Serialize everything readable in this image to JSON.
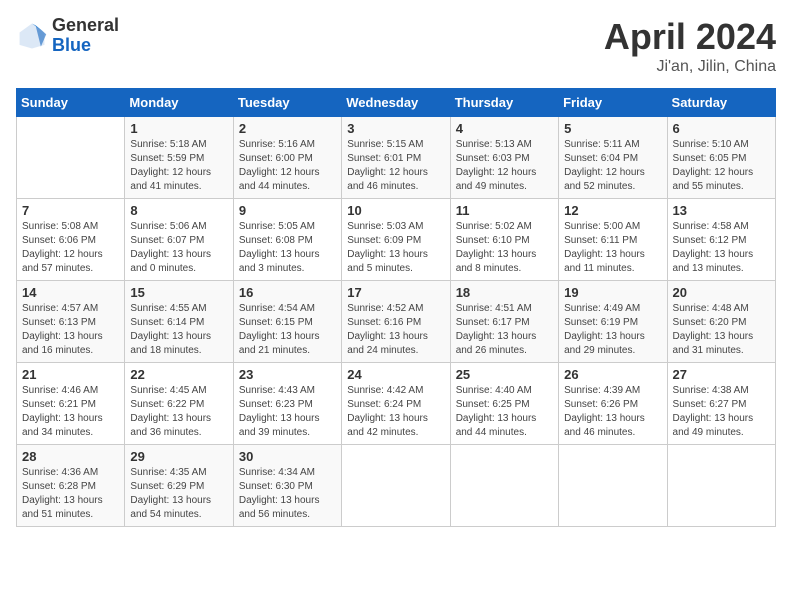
{
  "header": {
    "logo_general": "General",
    "logo_blue": "Blue",
    "title": "April 2024",
    "subtitle": "Ji'an, Jilin, China"
  },
  "days_of_week": [
    "Sunday",
    "Monday",
    "Tuesday",
    "Wednesday",
    "Thursday",
    "Friday",
    "Saturday"
  ],
  "weeks": [
    [
      {
        "day": "",
        "info": ""
      },
      {
        "day": "1",
        "info": "Sunrise: 5:18 AM\nSunset: 5:59 PM\nDaylight: 12 hours\nand 41 minutes."
      },
      {
        "day": "2",
        "info": "Sunrise: 5:16 AM\nSunset: 6:00 PM\nDaylight: 12 hours\nand 44 minutes."
      },
      {
        "day": "3",
        "info": "Sunrise: 5:15 AM\nSunset: 6:01 PM\nDaylight: 12 hours\nand 46 minutes."
      },
      {
        "day": "4",
        "info": "Sunrise: 5:13 AM\nSunset: 6:03 PM\nDaylight: 12 hours\nand 49 minutes."
      },
      {
        "day": "5",
        "info": "Sunrise: 5:11 AM\nSunset: 6:04 PM\nDaylight: 12 hours\nand 52 minutes."
      },
      {
        "day": "6",
        "info": "Sunrise: 5:10 AM\nSunset: 6:05 PM\nDaylight: 12 hours\nand 55 minutes."
      }
    ],
    [
      {
        "day": "7",
        "info": "Sunrise: 5:08 AM\nSunset: 6:06 PM\nDaylight: 12 hours\nand 57 minutes."
      },
      {
        "day": "8",
        "info": "Sunrise: 5:06 AM\nSunset: 6:07 PM\nDaylight: 13 hours\nand 0 minutes."
      },
      {
        "day": "9",
        "info": "Sunrise: 5:05 AM\nSunset: 6:08 PM\nDaylight: 13 hours\nand 3 minutes."
      },
      {
        "day": "10",
        "info": "Sunrise: 5:03 AM\nSunset: 6:09 PM\nDaylight: 13 hours\nand 5 minutes."
      },
      {
        "day": "11",
        "info": "Sunrise: 5:02 AM\nSunset: 6:10 PM\nDaylight: 13 hours\nand 8 minutes."
      },
      {
        "day": "12",
        "info": "Sunrise: 5:00 AM\nSunset: 6:11 PM\nDaylight: 13 hours\nand 11 minutes."
      },
      {
        "day": "13",
        "info": "Sunrise: 4:58 AM\nSunset: 6:12 PM\nDaylight: 13 hours\nand 13 minutes."
      }
    ],
    [
      {
        "day": "14",
        "info": "Sunrise: 4:57 AM\nSunset: 6:13 PM\nDaylight: 13 hours\nand 16 minutes."
      },
      {
        "day": "15",
        "info": "Sunrise: 4:55 AM\nSunset: 6:14 PM\nDaylight: 13 hours\nand 18 minutes."
      },
      {
        "day": "16",
        "info": "Sunrise: 4:54 AM\nSunset: 6:15 PM\nDaylight: 13 hours\nand 21 minutes."
      },
      {
        "day": "17",
        "info": "Sunrise: 4:52 AM\nSunset: 6:16 PM\nDaylight: 13 hours\nand 24 minutes."
      },
      {
        "day": "18",
        "info": "Sunrise: 4:51 AM\nSunset: 6:17 PM\nDaylight: 13 hours\nand 26 minutes."
      },
      {
        "day": "19",
        "info": "Sunrise: 4:49 AM\nSunset: 6:19 PM\nDaylight: 13 hours\nand 29 minutes."
      },
      {
        "day": "20",
        "info": "Sunrise: 4:48 AM\nSunset: 6:20 PM\nDaylight: 13 hours\nand 31 minutes."
      }
    ],
    [
      {
        "day": "21",
        "info": "Sunrise: 4:46 AM\nSunset: 6:21 PM\nDaylight: 13 hours\nand 34 minutes."
      },
      {
        "day": "22",
        "info": "Sunrise: 4:45 AM\nSunset: 6:22 PM\nDaylight: 13 hours\nand 36 minutes."
      },
      {
        "day": "23",
        "info": "Sunrise: 4:43 AM\nSunset: 6:23 PM\nDaylight: 13 hours\nand 39 minutes."
      },
      {
        "day": "24",
        "info": "Sunrise: 4:42 AM\nSunset: 6:24 PM\nDaylight: 13 hours\nand 42 minutes."
      },
      {
        "day": "25",
        "info": "Sunrise: 4:40 AM\nSunset: 6:25 PM\nDaylight: 13 hours\nand 44 minutes."
      },
      {
        "day": "26",
        "info": "Sunrise: 4:39 AM\nSunset: 6:26 PM\nDaylight: 13 hours\nand 46 minutes."
      },
      {
        "day": "27",
        "info": "Sunrise: 4:38 AM\nSunset: 6:27 PM\nDaylight: 13 hours\nand 49 minutes."
      }
    ],
    [
      {
        "day": "28",
        "info": "Sunrise: 4:36 AM\nSunset: 6:28 PM\nDaylight: 13 hours\nand 51 minutes."
      },
      {
        "day": "29",
        "info": "Sunrise: 4:35 AM\nSunset: 6:29 PM\nDaylight: 13 hours\nand 54 minutes."
      },
      {
        "day": "30",
        "info": "Sunrise: 4:34 AM\nSunset: 6:30 PM\nDaylight: 13 hours\nand 56 minutes."
      },
      {
        "day": "",
        "info": ""
      },
      {
        "day": "",
        "info": ""
      },
      {
        "day": "",
        "info": ""
      },
      {
        "day": "",
        "info": ""
      }
    ]
  ]
}
